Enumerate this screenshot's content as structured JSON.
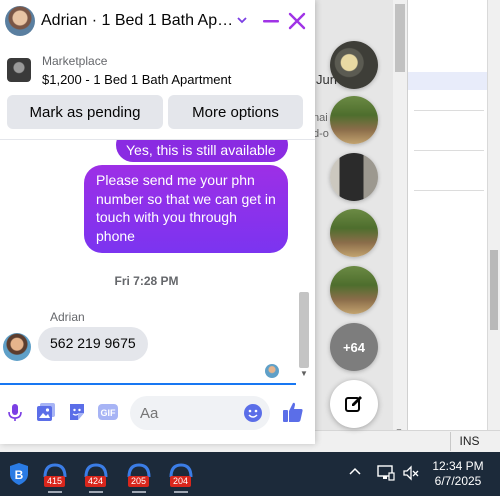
{
  "chat": {
    "title": "Adrian · 1 Bed 1 Bath Apart...",
    "listing": {
      "source": "Marketplace",
      "detail": "$1,200 - 1 Bed 1 Bath Apartment"
    },
    "buttons": {
      "mark_pending": "Mark as pending",
      "more_options": "More options"
    },
    "messages": [
      {
        "direction": "out",
        "text": "Yes, this is still available"
      },
      {
        "direction": "out",
        "text": "Please send me your phn number so that we can get in touch with you through phone"
      }
    ],
    "timestamp": "Fri 7:28 PM",
    "incoming": {
      "sender": "Adrian",
      "text": "562 219 9675"
    },
    "composer": {
      "placeholder": "Aa"
    }
  },
  "chat_heads": {
    "more_count": "+64"
  },
  "background": {
    "fragment_1": "Jun",
    "fragment_2": "nai",
    "fragment_3": "d-o",
    "status_ins": "INS"
  },
  "taskbar": {
    "apps": [
      {
        "icon": "app-icon",
        "badge": "415"
      },
      {
        "icon": "app-icon",
        "badge": "424"
      },
      {
        "icon": "app-icon",
        "badge": "205"
      },
      {
        "icon": "app-icon",
        "badge": "204"
      }
    ],
    "time": "12:34 PM",
    "date": "6/7/2025"
  },
  "colors": {
    "accent": "#8a2be2",
    "messenger_blue": "#1877f2",
    "taskbar": "#1c2a3a"
  }
}
